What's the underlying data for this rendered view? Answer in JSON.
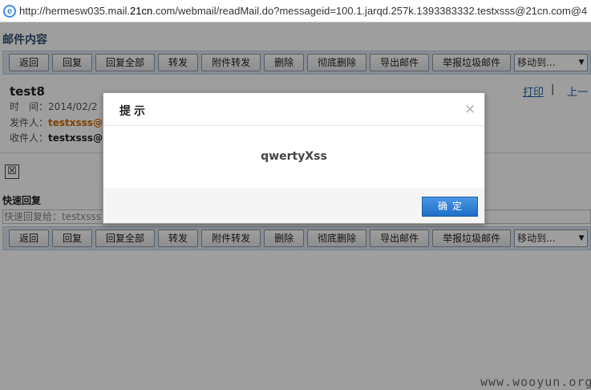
{
  "browser": {
    "url_prefix": "http://hermesw035.mail.",
    "url_domain": "21cn",
    "url_rest": ".com/webmail/readMail.do?messageid=100.1.jarqd.257k.1393383332.testxsss@21cn.com@4",
    "icon": "ie-icon"
  },
  "page": {
    "title": "邮件内容",
    "toolbar": [
      "返回",
      "回复",
      "回复全部",
      "转发",
      "附件转发",
      "删除",
      "彻底删除",
      "导出邮件",
      "举报垃圾邮件"
    ],
    "move_select": "移动到...",
    "subject": "test8",
    "time_label": "时　间：",
    "time_value": "2014/02/2",
    "from_label": "发件人：",
    "from_value": "testxsss@",
    "to_label": "收件人：",
    "to_value": "testxsss@",
    "print_link": "打印",
    "sep": "|",
    "prev_link": "上一",
    "attach_icon": "☒",
    "quick_reply_title": "快速回复",
    "quick_reply_placeholder": "快速回复给：testxsss"
  },
  "dialog": {
    "title": "提示",
    "close": "×",
    "message": "qwertyXss",
    "ok": "确定"
  },
  "watermark": "www.wooyun.org"
}
